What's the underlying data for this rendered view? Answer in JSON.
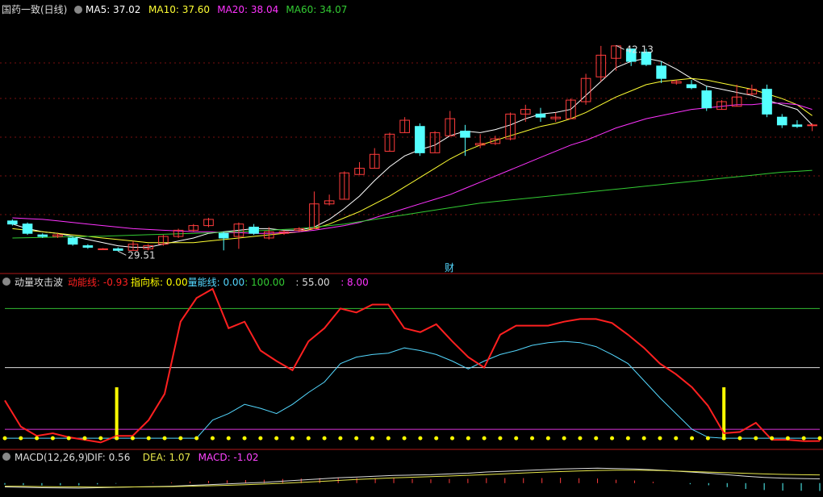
{
  "colors": {
    "up": "#ff3c3c",
    "down": "#54ffff",
    "ma5": "#ffffff",
    "ma10": "#ffff33",
    "ma20": "#ff33ff",
    "ma60": "#33cc33",
    "grid": "#7a1010",
    "frame": "#b01818",
    "energy": "#ff2020",
    "pointer": "#ffff00",
    "volume_line": "#54d8ff",
    "dif": "#dddddd",
    "dea": "#e8e84a",
    "macd": "#ff44ff"
  },
  "main_panel": {
    "stock_name": "国药一致(日线)",
    "legend": [
      {
        "key": "ma5",
        "text": "MA5: 37.02"
      },
      {
        "key": "ma10",
        "text": "MA10: 37.60"
      },
      {
        "key": "ma20",
        "text": "MA20: 38.04"
      },
      {
        "key": "ma60",
        "text": "MA60: 34.07"
      }
    ],
    "high_label": "42.13",
    "low_label": "29.51",
    "event_badge": "财"
  },
  "indicator_panel": {
    "name": "动量攻击波",
    "legend": [
      {
        "key": "energy",
        "text": "动能线: -0.93"
      },
      {
        "key": "pointer",
        "text": "指向标: 0.00"
      },
      {
        "key": "volume_line",
        "text": "量能线: 0.00"
      },
      {
        "key": "ref1",
        "text": ": 100.00"
      },
      {
        "key": "ref2",
        "text": ": 55.00"
      },
      {
        "key": "ref3",
        "text": ": 8.00"
      }
    ]
  },
  "macd_panel": {
    "name": "MACD(12,26,9)",
    "legend": [
      {
        "key": "dif",
        "text": "DIF: 0.56"
      },
      {
        "key": "dea",
        "text": "DEA: 1.07"
      },
      {
        "key": "macd",
        "text": "MACD: -1.02"
      }
    ]
  },
  "chart_data": [
    {
      "type": "candlestick",
      "title": "国药一致(日线)",
      "ylim": [
        28.5,
        43.5
      ],
      "ohlc": [
        [
          30.8,
          30.9,
          30.5,
          30.6
        ],
        [
          30.6,
          30.7,
          29.9,
          30.0
        ],
        [
          29.9,
          30.0,
          29.7,
          29.8
        ],
        [
          29.8,
          30.0,
          29.7,
          29.9
        ],
        [
          29.7,
          29.8,
          29.2,
          29.3
        ],
        [
          29.2,
          29.3,
          29.0,
          29.1
        ],
        [
          29.0,
          29.05,
          28.95,
          29.0
        ],
        [
          29.0,
          29.1,
          28.85,
          28.9
        ],
        [
          28.9,
          29.5,
          28.9,
          29.3
        ],
        [
          29.0,
          29.3,
          28.9,
          29.2
        ],
        [
          29.3,
          29.9,
          29.2,
          29.8
        ],
        [
          29.8,
          30.3,
          29.7,
          30.2
        ],
        [
          30.2,
          30.6,
          30.1,
          30.5
        ],
        [
          30.5,
          31.0,
          30.4,
          30.9
        ],
        [
          30.0,
          30.1,
          28.9,
          29.7
        ],
        [
          29.8,
          30.7,
          29.0,
          30.6
        ],
        [
          30.4,
          30.6,
          29.9,
          30.0
        ],
        [
          29.7,
          30.4,
          29.6,
          30.1
        ],
        [
          30.0,
          30.2,
          29.9,
          30.1
        ],
        [
          30.2,
          30.4,
          30.1,
          30.3
        ],
        [
          30.3,
          32.7,
          30.3,
          31.9
        ],
        [
          31.9,
          32.5,
          31.8,
          32.1
        ],
        [
          32.2,
          34.0,
          32.2,
          33.9
        ],
        [
          33.8,
          34.6,
          33.8,
          34.2
        ],
        [
          34.2,
          35.5,
          34.2,
          35.1
        ],
        [
          35.3,
          36.5,
          35.3,
          36.4
        ],
        [
          36.5,
          37.5,
          36.5,
          37.3
        ],
        [
          36.9,
          37.1,
          35.0,
          35.2
        ],
        [
          35.2,
          36.6,
          35.2,
          36.5
        ],
        [
          36.3,
          37.9,
          36.3,
          37.4
        ],
        [
          36.6,
          37.0,
          35.0,
          36.2
        ],
        [
          35.7,
          36.4,
          35.5,
          35.8
        ],
        [
          35.8,
          36.3,
          35.7,
          36.1
        ],
        [
          36.1,
          37.8,
          36.0,
          37.7
        ],
        [
          37.7,
          38.3,
          37.2,
          38.0
        ],
        [
          37.7,
          38.1,
          37.2,
          37.5
        ],
        [
          37.4,
          37.8,
          37.2,
          37.5
        ],
        [
          37.4,
          38.7,
          37.4,
          38.6
        ],
        [
          38.5,
          40.3,
          38.3,
          40.0
        ],
        [
          40.1,
          42.1,
          39.8,
          41.5
        ],
        [
          41.3,
          42.13,
          40.5,
          42.1
        ],
        [
          41.9,
          41.9,
          40.8,
          41.1
        ],
        [
          41.7,
          41.9,
          40.8,
          40.9
        ],
        [
          40.8,
          41.1,
          39.7,
          40.0
        ],
        [
          39.7,
          39.9,
          39.6,
          39.8
        ],
        [
          39.6,
          39.9,
          39.3,
          39.4
        ],
        [
          39.2,
          39.5,
          37.9,
          38.1
        ],
        [
          38.0,
          38.6,
          38.0,
          38.5
        ],
        [
          38.2,
          39.6,
          38.2,
          38.8
        ],
        [
          39.0,
          39.6,
          38.9,
          39.3
        ],
        [
          39.3,
          39.6,
          37.5,
          37.7
        ],
        [
          37.5,
          37.7,
          36.8,
          37.0
        ],
        [
          37.0,
          37.3,
          36.8,
          36.9
        ],
        [
          37.0,
          37.1,
          36.6,
          37.0
        ]
      ],
      "series": [
        {
          "name": "MA5",
          "values": [
            30.6,
            30.3,
            30.1,
            30.0,
            29.8,
            29.6,
            29.4,
            29.2,
            29.1,
            29.1,
            29.3,
            29.5,
            29.7,
            30.0,
            30.1,
            30.2,
            30.3,
            30.3,
            30.2,
            30.2,
            30.4,
            30.9,
            31.6,
            32.4,
            33.4,
            34.3,
            35.0,
            35.4,
            35.7,
            36.3,
            36.6,
            36.5,
            36.7,
            37.0,
            37.4,
            37.7,
            37.8,
            38.0,
            38.9,
            39.8,
            40.7,
            41.1,
            41.3,
            41.1,
            40.6,
            40.0,
            39.5,
            39.3,
            39.1,
            38.9,
            38.6,
            38.3,
            38.0,
            37.0
          ]
        },
        {
          "name": "MA10",
          "values": [
            30.3,
            30.2,
            30.1,
            30.0,
            29.9,
            29.8,
            29.7,
            29.6,
            29.5,
            29.4,
            29.4,
            29.4,
            29.4,
            29.5,
            29.6,
            29.7,
            29.8,
            29.9,
            30.0,
            30.1,
            30.3,
            30.6,
            31.0,
            31.4,
            31.9,
            32.4,
            33.0,
            33.6,
            34.2,
            34.8,
            35.3,
            35.7,
            36.0,
            36.3,
            36.6,
            36.9,
            37.1,
            37.4,
            37.8,
            38.3,
            38.8,
            39.2,
            39.6,
            39.8,
            39.9,
            40.0,
            39.9,
            39.7,
            39.5,
            39.3,
            39.0,
            38.7,
            38.3,
            37.6
          ]
        },
        {
          "name": "MA20",
          "values": [
            31.0,
            30.95,
            30.9,
            30.8,
            30.7,
            30.6,
            30.5,
            30.4,
            30.3,
            30.25,
            30.2,
            30.15,
            30.1,
            30.1,
            30.05,
            30.05,
            30.0,
            30.0,
            30.05,
            30.1,
            30.2,
            30.35,
            30.5,
            30.7,
            31.0,
            31.3,
            31.6,
            31.9,
            32.2,
            32.5,
            32.9,
            33.3,
            33.7,
            34.1,
            34.5,
            34.9,
            35.3,
            35.7,
            36.0,
            36.4,
            36.8,
            37.1,
            37.4,
            37.6,
            37.8,
            38.0,
            38.1,
            38.2,
            38.3,
            38.3,
            38.4,
            38.4,
            38.3,
            38.0
          ]
        },
        {
          "name": "MA60",
          "values": [
            29.7,
            29.72,
            29.74,
            29.76,
            29.78,
            29.8,
            29.82,
            29.85,
            29.88,
            29.91,
            29.94,
            29.97,
            30.0,
            30.03,
            30.07,
            30.11,
            30.15,
            30.2,
            30.25,
            30.3,
            30.4,
            30.5,
            30.6,
            30.75,
            30.9,
            31.05,
            31.2,
            31.35,
            31.5,
            31.65,
            31.8,
            31.95,
            32.05,
            32.15,
            32.25,
            32.35,
            32.45,
            32.55,
            32.65,
            32.75,
            32.85,
            32.95,
            33.05,
            33.15,
            33.25,
            33.35,
            33.45,
            33.55,
            33.65,
            33.75,
            33.85,
            33.95,
            34.0,
            34.07
          ]
        }
      ]
    },
    {
      "type": "line",
      "title": "动量攻击波",
      "ylim": [
        -3,
        115
      ],
      "hlines": [
        100.0,
        55.0,
        8.0
      ],
      "series": [
        {
          "name": "动能线",
          "values": [
            30,
            10,
            3,
            5,
            2,
            0,
            -2,
            3,
            3,
            15,
            35,
            90,
            108,
            115,
            85,
            90,
            68,
            60,
            53,
            75,
            85,
            100,
            97,
            103,
            103,
            85,
            82,
            88,
            75,
            63,
            55,
            80,
            87,
            87,
            87,
            90,
            92,
            92,
            89,
            80,
            70,
            58,
            50,
            40,
            26,
            5,
            6,
            13,
            0,
            0,
            -1,
            -0.93
          ]
        },
        {
          "name": "量能线",
          "values": [
            0,
            0,
            0,
            0,
            0,
            0,
            0,
            0,
            0,
            0,
            0,
            0,
            0,
            15,
            20,
            27,
            24,
            20,
            27,
            36,
            44,
            58,
            63,
            65,
            66,
            70,
            68,
            65,
            60,
            54,
            60,
            65,
            68,
            72,
            74,
            75,
            74,
            71,
            65,
            58,
            45,
            32,
            20,
            8,
            2,
            0,
            0,
            0,
            0,
            0,
            0,
            0
          ]
        },
        {
          "name": "指向标",
          "values": [
            0,
            0,
            0,
            0,
            0,
            0,
            0,
            40,
            0,
            0,
            0,
            0,
            0,
            0,
            0,
            0,
            0,
            0,
            0,
            0,
            0,
            0,
            0,
            0,
            0,
            0,
            0,
            0,
            0,
            0,
            0,
            0,
            0,
            0,
            0,
            0,
            0,
            0,
            0,
            0,
            0,
            0,
            0,
            0,
            0,
            40,
            0,
            0,
            0,
            0,
            0,
            0
          ]
        }
      ]
    },
    {
      "type": "line",
      "title": "MACD(12,26,9)",
      "ylim": [
        -1.6,
        2.4
      ],
      "series": [
        {
          "name": "DIF",
          "values": [
            -0.5,
            -0.55,
            -0.6,
            -0.62,
            -0.65,
            -0.6,
            -0.55,
            -0.5,
            -0.45,
            -0.4,
            -0.3,
            -0.2,
            -0.1,
            0.0,
            0.1,
            0.25,
            0.4,
            0.55,
            0.7,
            0.8,
            0.9,
            1.0,
            1.05,
            1.1,
            1.2,
            1.3,
            1.45,
            1.55,
            1.65,
            1.75,
            1.85,
            1.9,
            1.95,
            1.9,
            1.85,
            1.75,
            1.6,
            1.45,
            1.3,
            1.1,
            0.9,
            0.75,
            0.65,
            0.6,
            0.56
          ]
        },
        {
          "name": "DEA",
          "values": [
            -0.4,
            -0.42,
            -0.45,
            -0.48,
            -0.5,
            -0.52,
            -0.52,
            -0.5,
            -0.48,
            -0.45,
            -0.4,
            -0.35,
            -0.28,
            -0.2,
            -0.12,
            -0.02,
            0.1,
            0.22,
            0.35,
            0.47,
            0.58,
            0.68,
            0.77,
            0.85,
            0.93,
            1.02,
            1.12,
            1.22,
            1.32,
            1.42,
            1.5,
            1.58,
            1.65,
            1.68,
            1.68,
            1.66,
            1.6,
            1.52,
            1.44,
            1.36,
            1.28,
            1.2,
            1.14,
            1.1,
            1.07
          ]
        },
        {
          "name": "MACD",
          "values": [
            -0.2,
            -0.26,
            -0.3,
            -0.28,
            -0.3,
            -0.16,
            -0.06,
            0.0,
            0.06,
            0.1,
            0.2,
            0.3,
            0.36,
            0.4,
            0.44,
            0.54,
            0.6,
            0.66,
            0.7,
            0.66,
            0.64,
            0.64,
            0.56,
            0.5,
            0.54,
            0.56,
            0.66,
            0.66,
            0.66,
            0.66,
            0.7,
            0.64,
            0.6,
            0.44,
            0.34,
            0.18,
            0.0,
            -0.14,
            -0.28,
            -0.52,
            -0.76,
            -0.9,
            -0.98,
            -1.0,
            -1.02
          ]
        }
      ]
    }
  ]
}
